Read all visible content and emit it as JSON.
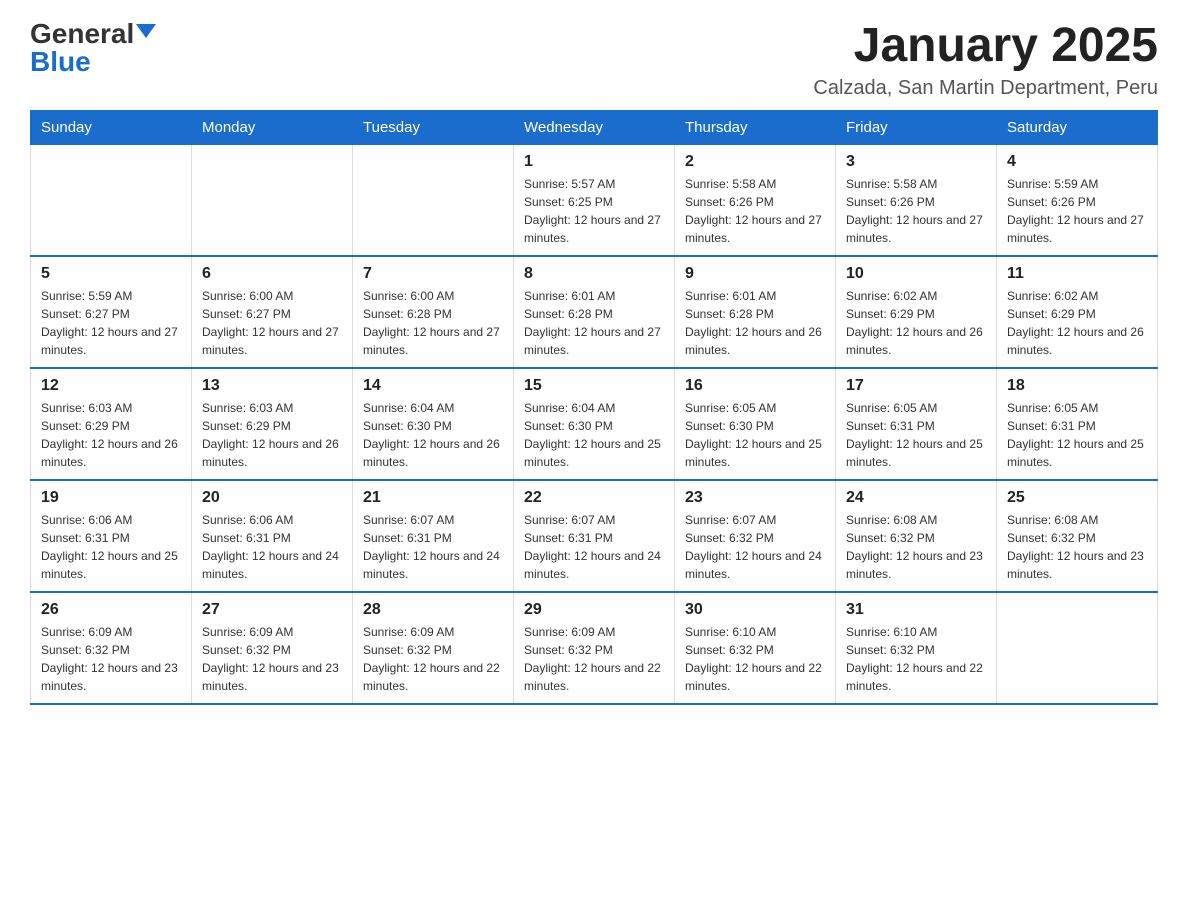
{
  "logo": {
    "general": "General",
    "blue": "Blue"
  },
  "title": "January 2025",
  "location": "Calzada, San Martin Department, Peru",
  "headers": [
    "Sunday",
    "Monday",
    "Tuesday",
    "Wednesday",
    "Thursday",
    "Friday",
    "Saturday"
  ],
  "weeks": [
    [
      {
        "day": "",
        "info": ""
      },
      {
        "day": "",
        "info": ""
      },
      {
        "day": "",
        "info": ""
      },
      {
        "day": "1",
        "info": "Sunrise: 5:57 AM\nSunset: 6:25 PM\nDaylight: 12 hours and 27 minutes."
      },
      {
        "day": "2",
        "info": "Sunrise: 5:58 AM\nSunset: 6:26 PM\nDaylight: 12 hours and 27 minutes."
      },
      {
        "day": "3",
        "info": "Sunrise: 5:58 AM\nSunset: 6:26 PM\nDaylight: 12 hours and 27 minutes."
      },
      {
        "day": "4",
        "info": "Sunrise: 5:59 AM\nSunset: 6:26 PM\nDaylight: 12 hours and 27 minutes."
      }
    ],
    [
      {
        "day": "5",
        "info": "Sunrise: 5:59 AM\nSunset: 6:27 PM\nDaylight: 12 hours and 27 minutes."
      },
      {
        "day": "6",
        "info": "Sunrise: 6:00 AM\nSunset: 6:27 PM\nDaylight: 12 hours and 27 minutes."
      },
      {
        "day": "7",
        "info": "Sunrise: 6:00 AM\nSunset: 6:28 PM\nDaylight: 12 hours and 27 minutes."
      },
      {
        "day": "8",
        "info": "Sunrise: 6:01 AM\nSunset: 6:28 PM\nDaylight: 12 hours and 27 minutes."
      },
      {
        "day": "9",
        "info": "Sunrise: 6:01 AM\nSunset: 6:28 PM\nDaylight: 12 hours and 26 minutes."
      },
      {
        "day": "10",
        "info": "Sunrise: 6:02 AM\nSunset: 6:29 PM\nDaylight: 12 hours and 26 minutes."
      },
      {
        "day": "11",
        "info": "Sunrise: 6:02 AM\nSunset: 6:29 PM\nDaylight: 12 hours and 26 minutes."
      }
    ],
    [
      {
        "day": "12",
        "info": "Sunrise: 6:03 AM\nSunset: 6:29 PM\nDaylight: 12 hours and 26 minutes."
      },
      {
        "day": "13",
        "info": "Sunrise: 6:03 AM\nSunset: 6:29 PM\nDaylight: 12 hours and 26 minutes."
      },
      {
        "day": "14",
        "info": "Sunrise: 6:04 AM\nSunset: 6:30 PM\nDaylight: 12 hours and 26 minutes."
      },
      {
        "day": "15",
        "info": "Sunrise: 6:04 AM\nSunset: 6:30 PM\nDaylight: 12 hours and 25 minutes."
      },
      {
        "day": "16",
        "info": "Sunrise: 6:05 AM\nSunset: 6:30 PM\nDaylight: 12 hours and 25 minutes."
      },
      {
        "day": "17",
        "info": "Sunrise: 6:05 AM\nSunset: 6:31 PM\nDaylight: 12 hours and 25 minutes."
      },
      {
        "day": "18",
        "info": "Sunrise: 6:05 AM\nSunset: 6:31 PM\nDaylight: 12 hours and 25 minutes."
      }
    ],
    [
      {
        "day": "19",
        "info": "Sunrise: 6:06 AM\nSunset: 6:31 PM\nDaylight: 12 hours and 25 minutes."
      },
      {
        "day": "20",
        "info": "Sunrise: 6:06 AM\nSunset: 6:31 PM\nDaylight: 12 hours and 24 minutes."
      },
      {
        "day": "21",
        "info": "Sunrise: 6:07 AM\nSunset: 6:31 PM\nDaylight: 12 hours and 24 minutes."
      },
      {
        "day": "22",
        "info": "Sunrise: 6:07 AM\nSunset: 6:31 PM\nDaylight: 12 hours and 24 minutes."
      },
      {
        "day": "23",
        "info": "Sunrise: 6:07 AM\nSunset: 6:32 PM\nDaylight: 12 hours and 24 minutes."
      },
      {
        "day": "24",
        "info": "Sunrise: 6:08 AM\nSunset: 6:32 PM\nDaylight: 12 hours and 23 minutes."
      },
      {
        "day": "25",
        "info": "Sunrise: 6:08 AM\nSunset: 6:32 PM\nDaylight: 12 hours and 23 minutes."
      }
    ],
    [
      {
        "day": "26",
        "info": "Sunrise: 6:09 AM\nSunset: 6:32 PM\nDaylight: 12 hours and 23 minutes."
      },
      {
        "day": "27",
        "info": "Sunrise: 6:09 AM\nSunset: 6:32 PM\nDaylight: 12 hours and 23 minutes."
      },
      {
        "day": "28",
        "info": "Sunrise: 6:09 AM\nSunset: 6:32 PM\nDaylight: 12 hours and 22 minutes."
      },
      {
        "day": "29",
        "info": "Sunrise: 6:09 AM\nSunset: 6:32 PM\nDaylight: 12 hours and 22 minutes."
      },
      {
        "day": "30",
        "info": "Sunrise: 6:10 AM\nSunset: 6:32 PM\nDaylight: 12 hours and 22 minutes."
      },
      {
        "day": "31",
        "info": "Sunrise: 6:10 AM\nSunset: 6:32 PM\nDaylight: 12 hours and 22 minutes."
      },
      {
        "day": "",
        "info": ""
      }
    ]
  ]
}
